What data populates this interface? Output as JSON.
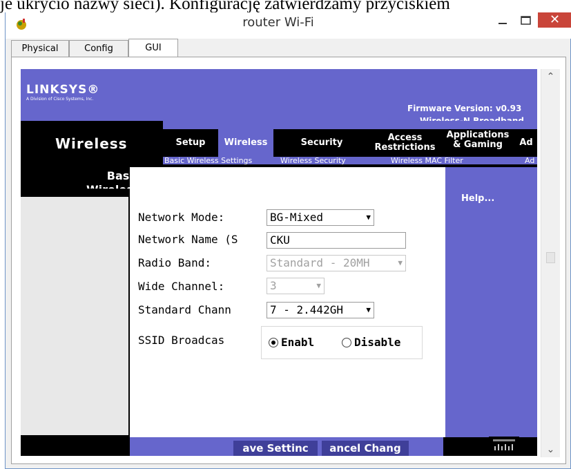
{
  "document_text": "je ukryció nazwy sieci). Konfigurację zatwierdzamy przyciskiem",
  "window": {
    "title": "router Wi-Fi",
    "minimize": "—",
    "maximize": "☐",
    "close": "✕"
  },
  "tabs": [
    {
      "label": "Physical"
    },
    {
      "label": "Config"
    },
    {
      "label": "GUI"
    }
  ],
  "linksys": {
    "logo": "LINKSYS®",
    "logo_sub": "A Division of Cisco Systems, Inc.",
    "firmware": "Firmware Version: v0.93",
    "product": "Wireless-N Broadband",
    "section_title": "Wireless",
    "nav": [
      "Setup",
      "Wireless",
      "Security",
      "Access Restrictions",
      "Applications & Gaming",
      "Administration"
    ],
    "nav_display": {
      "setup": "Setup",
      "wireless": "Wireless",
      "security": "Security",
      "access1": "Access",
      "access2": "Restrictions",
      "apps1": "Applications",
      "apps2": "& Gaming",
      "admin": "Ad"
    },
    "subnav": [
      "Basic Wireless Settings",
      "Wireless Security",
      "Wireless MAC Filter",
      "Ad"
    ],
    "left_title_1": "Basic",
    "left_title_2": "Wireless",
    "help": "Help..."
  },
  "form": {
    "network_mode": {
      "label": "Network Mode:",
      "value": "BG-Mixed"
    },
    "network_name": {
      "label": "Network Name (S",
      "value": "CKU"
    },
    "radio_band": {
      "label": "Radio Band:",
      "value": "Standard - 20MH"
    },
    "wide_channel": {
      "label": "Wide Channel:",
      "value": "3"
    },
    "standard_channel": {
      "label": "Standard Chann",
      "value": "7 - 2.442GH"
    },
    "ssid_broadcast": {
      "label": "SSID Broadcas",
      "enable": "Enabl",
      "disable": "Disable",
      "selected": "enable"
    }
  },
  "buttons": {
    "save": "ave Settinc",
    "cancel": "ancel Chang"
  },
  "colors": {
    "linksys_purple": "#6666cc",
    "close_red": "#c9453a"
  }
}
